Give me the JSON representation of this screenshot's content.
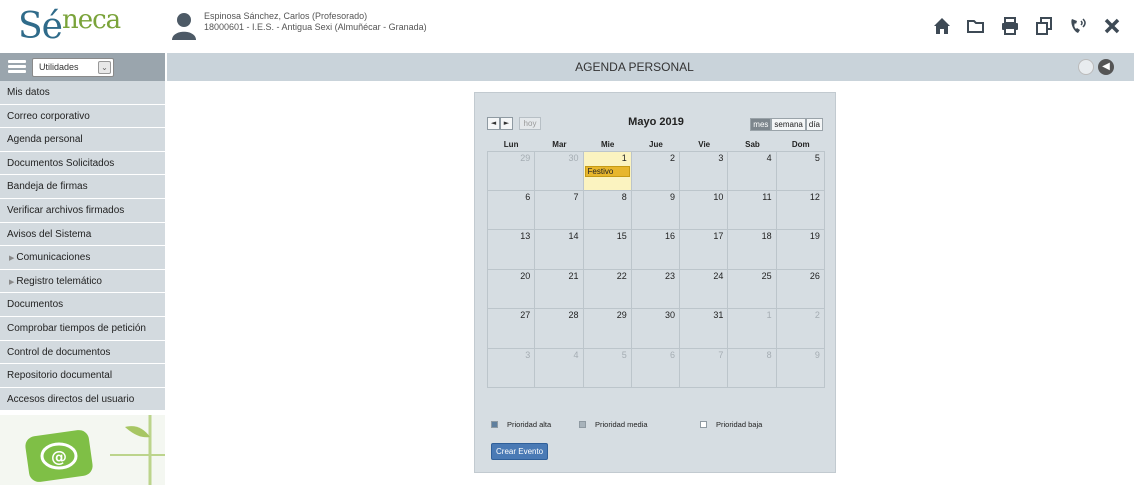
{
  "header": {
    "logo_text_main": "Sé",
    "logo_text_accent": "neca",
    "user_name": "Espinosa Sánchez, Carlos (Profesorado)",
    "user_center": "18000601 - I.E.S. - Antigua Sexi (Almuñécar - Granada)",
    "tools": [
      "home-icon",
      "folder-icon",
      "print-icon",
      "copy-icon",
      "phone-icon",
      "close-icon"
    ]
  },
  "sidebar": {
    "select_value": "Utilidades",
    "items": [
      {
        "label": "Mis datos",
        "sub": false
      },
      {
        "label": "Correo corporativo",
        "sub": false
      },
      {
        "label": "Agenda personal",
        "sub": false
      },
      {
        "label": "Documentos Solicitados",
        "sub": false
      },
      {
        "label": "Bandeja de firmas",
        "sub": false
      },
      {
        "label": "Verificar archivos firmados",
        "sub": false
      },
      {
        "label": "Avisos del Sistema",
        "sub": false
      },
      {
        "label": "Comunicaciones",
        "sub": true
      },
      {
        "label": "Registro telemático",
        "sub": true
      },
      {
        "label": "Documentos",
        "sub": false
      },
      {
        "label": "Comprobar tiempos de petición",
        "sub": false
      },
      {
        "label": "Control de documentos",
        "sub": false
      },
      {
        "label": "Repositorio documental",
        "sub": false
      },
      {
        "label": "Accesos directos del usuario",
        "sub": false
      }
    ]
  },
  "main": {
    "title": "AGENDA PERSONAL"
  },
  "calendar": {
    "prev_label": "◄",
    "next_label": "►",
    "today_label": "hoy",
    "month_title": "Mayo 2019",
    "views": [
      {
        "label": "mes",
        "active": true
      },
      {
        "label": "semana",
        "active": false
      },
      {
        "label": "día",
        "active": false
      }
    ],
    "weekdays": [
      "Lun",
      "Mar",
      "Mie",
      "Jue",
      "Vie",
      "Sab",
      "Dom"
    ],
    "weeks": [
      [
        {
          "d": "29",
          "o": true
        },
        {
          "d": "30",
          "o": true
        },
        {
          "d": "1",
          "t": true,
          "ev": "Festivo"
        },
        {
          "d": "2"
        },
        {
          "d": "3"
        },
        {
          "d": "4"
        },
        {
          "d": "5"
        }
      ],
      [
        {
          "d": "6"
        },
        {
          "d": "7"
        },
        {
          "d": "8"
        },
        {
          "d": "9"
        },
        {
          "d": "10"
        },
        {
          "d": "11"
        },
        {
          "d": "12"
        }
      ],
      [
        {
          "d": "13"
        },
        {
          "d": "14"
        },
        {
          "d": "15"
        },
        {
          "d": "16"
        },
        {
          "d": "17"
        },
        {
          "d": "18"
        },
        {
          "d": "19"
        }
      ],
      [
        {
          "d": "20"
        },
        {
          "d": "21"
        },
        {
          "d": "22"
        },
        {
          "d": "23"
        },
        {
          "d": "24"
        },
        {
          "d": "25"
        },
        {
          "d": "26"
        }
      ],
      [
        {
          "d": "27"
        },
        {
          "d": "28"
        },
        {
          "d": "29"
        },
        {
          "d": "30"
        },
        {
          "d": "31"
        },
        {
          "d": "1",
          "o": true
        },
        {
          "d": "2",
          "o": true
        }
      ],
      [
        {
          "d": "3",
          "o": true
        },
        {
          "d": "4",
          "o": true
        },
        {
          "d": "5",
          "o": true
        },
        {
          "d": "6",
          "o": true
        },
        {
          "d": "7",
          "o": true
        },
        {
          "d": "8",
          "o": true
        },
        {
          "d": "9",
          "o": true
        }
      ]
    ],
    "legend": [
      {
        "label": "Prioridad alta",
        "color": "#5f7f9e"
      },
      {
        "label": "Prioridad media",
        "color": "#a8b3bb"
      },
      {
        "label": "Prioridad baja",
        "color": "#ffffff"
      }
    ],
    "create_label": "Crear Evento"
  }
}
